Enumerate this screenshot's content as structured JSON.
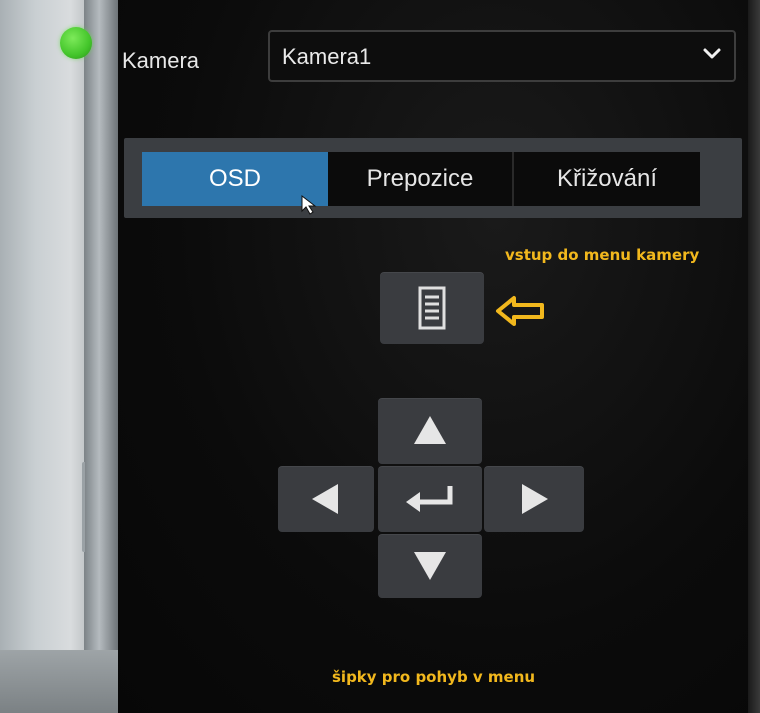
{
  "camera": {
    "label": "Kamera",
    "selected": "Kamera1"
  },
  "tabs": [
    {
      "label": "OSD",
      "active": true
    },
    {
      "label": "Prepozice",
      "active": false
    },
    {
      "label": "Křižování",
      "active": false
    }
  ],
  "annotations": {
    "menu_hint": "vstup do menu kamery",
    "arrows_hint": "šipky pro pohyb v menu"
  },
  "icons": {
    "status": "green-dot",
    "dropdown": "chevron-down-icon",
    "menu": "menu-list-icon",
    "up": "arrow-up-icon",
    "down": "arrow-down-icon",
    "left": "arrow-left-icon",
    "right": "arrow-right-icon",
    "enter": "enter-icon",
    "pointer": "mouse-cursor-icon",
    "annotation_arrow": "outline-arrow-left-icon"
  },
  "colors": {
    "active_tab": "#2d76ad",
    "annotation": "#f2b81d",
    "status_indicator": "#43c52a",
    "button": "#3a3c40"
  }
}
